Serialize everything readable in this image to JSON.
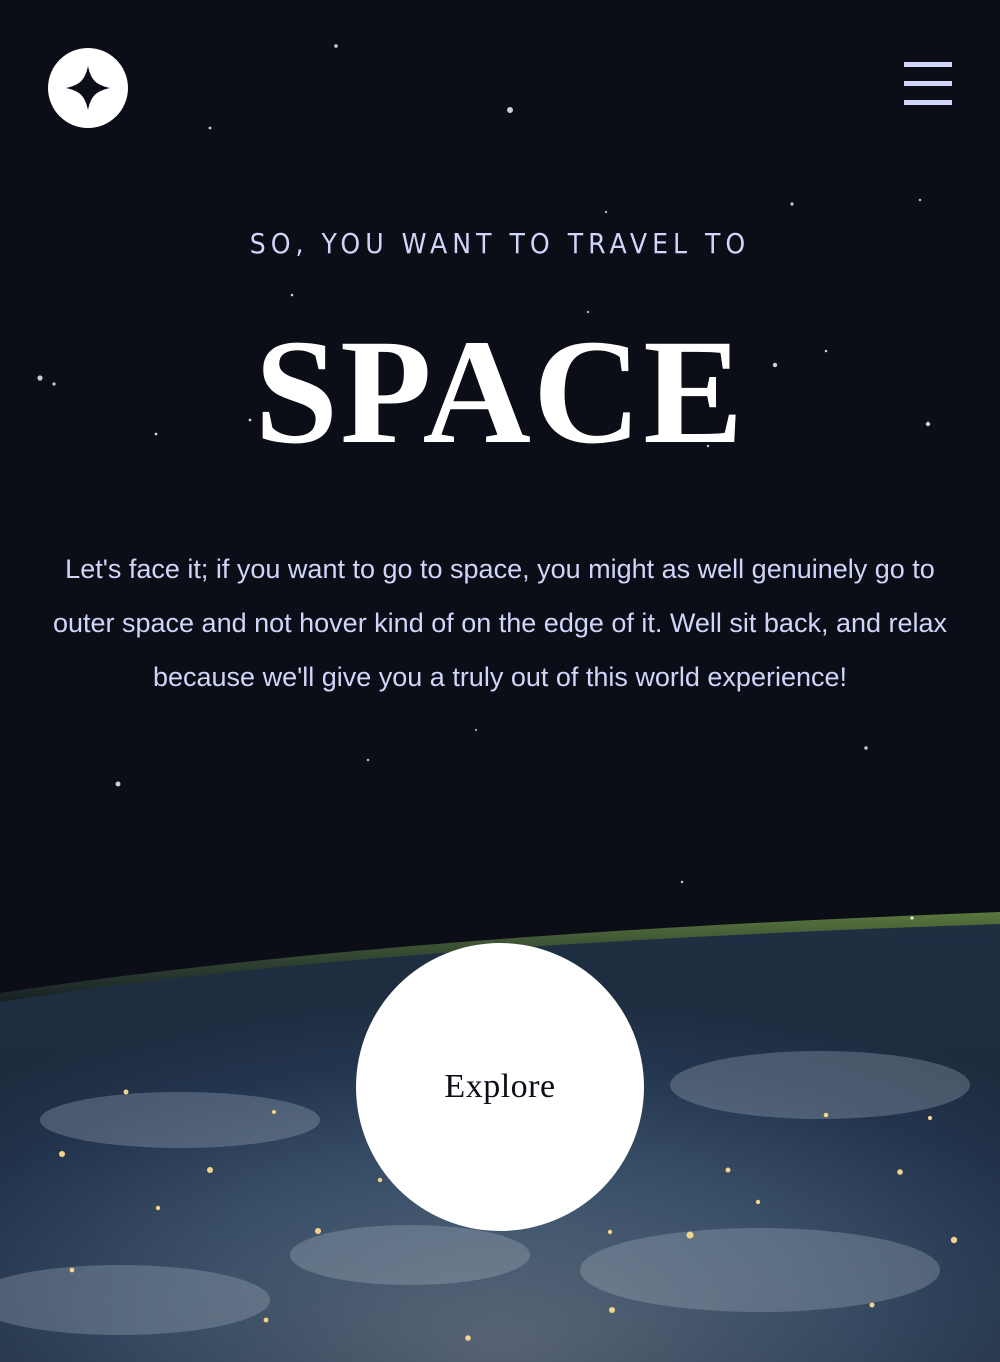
{
  "header": {
    "logo_icon": "star-logo-icon",
    "menu_icon": "hamburger-menu-icon"
  },
  "hero": {
    "eyebrow": "SO, YOU WANT TO TRAVEL TO",
    "title": "SPACE",
    "description": "Let's face it; if you want to go to space, you might as well genuinely go to outer space and not hover kind of on the edge of it. Well sit back, and relax because we'll give you a truly out of this world experience!",
    "cta_label": "Explore"
  },
  "colors": {
    "background": "#0b0d17",
    "accent_text": "#d0d6f9",
    "white": "#ffffff"
  }
}
